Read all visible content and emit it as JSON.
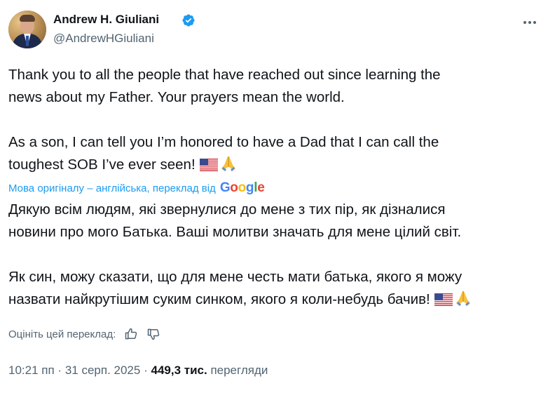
{
  "author": {
    "name": "Andrew H. Giuliani",
    "handle": "@AndrewHGiuliani"
  },
  "tweet": {
    "original_lines": [
      "Thank you to all the people that have reached out since learning the",
      "news about my Father. Your prayers mean the world.",
      "As a son, I can tell you I’m honored to have a Dad that I can call the",
      "toughest SOB I’ve ever seen!"
    ],
    "translated_lines": [
      "Дякую всім людям, які звернулися до мене з тих пір, як дізналися",
      "новини про мого Батька. Ваші молитви значать для мене цілий світ.",
      "Як син, можу сказати, що для мене честь мати батька, якого я можу",
      "назвати найкрутішим суким синком, якого я коли-небудь бачив!"
    ],
    "translation_note": "Мова оригіналу – англійська, переклад від",
    "google_logo": {
      "G": "G",
      "o1": "o",
      "o2": "o",
      "g": "g",
      "l": "l",
      "e": "e"
    },
    "emoji": [
      "us-flag",
      "folded-hands"
    ]
  },
  "rating": {
    "label": "Оцініть цей переклад:"
  },
  "meta": {
    "time": "10:21 пп",
    "sep1": "·",
    "date": "31 серп. 2025",
    "sep2": "·",
    "views_count": "449,3 тис.",
    "views_label": "перегляди"
  },
  "colors": {
    "accent": "#1d9bf0",
    "text": "#0f1419",
    "secondary": "#536471"
  },
  "icons": [
    "verified-badge-icon",
    "more-options-icon",
    "thumbs-up-icon",
    "thumbs-down-icon"
  ]
}
